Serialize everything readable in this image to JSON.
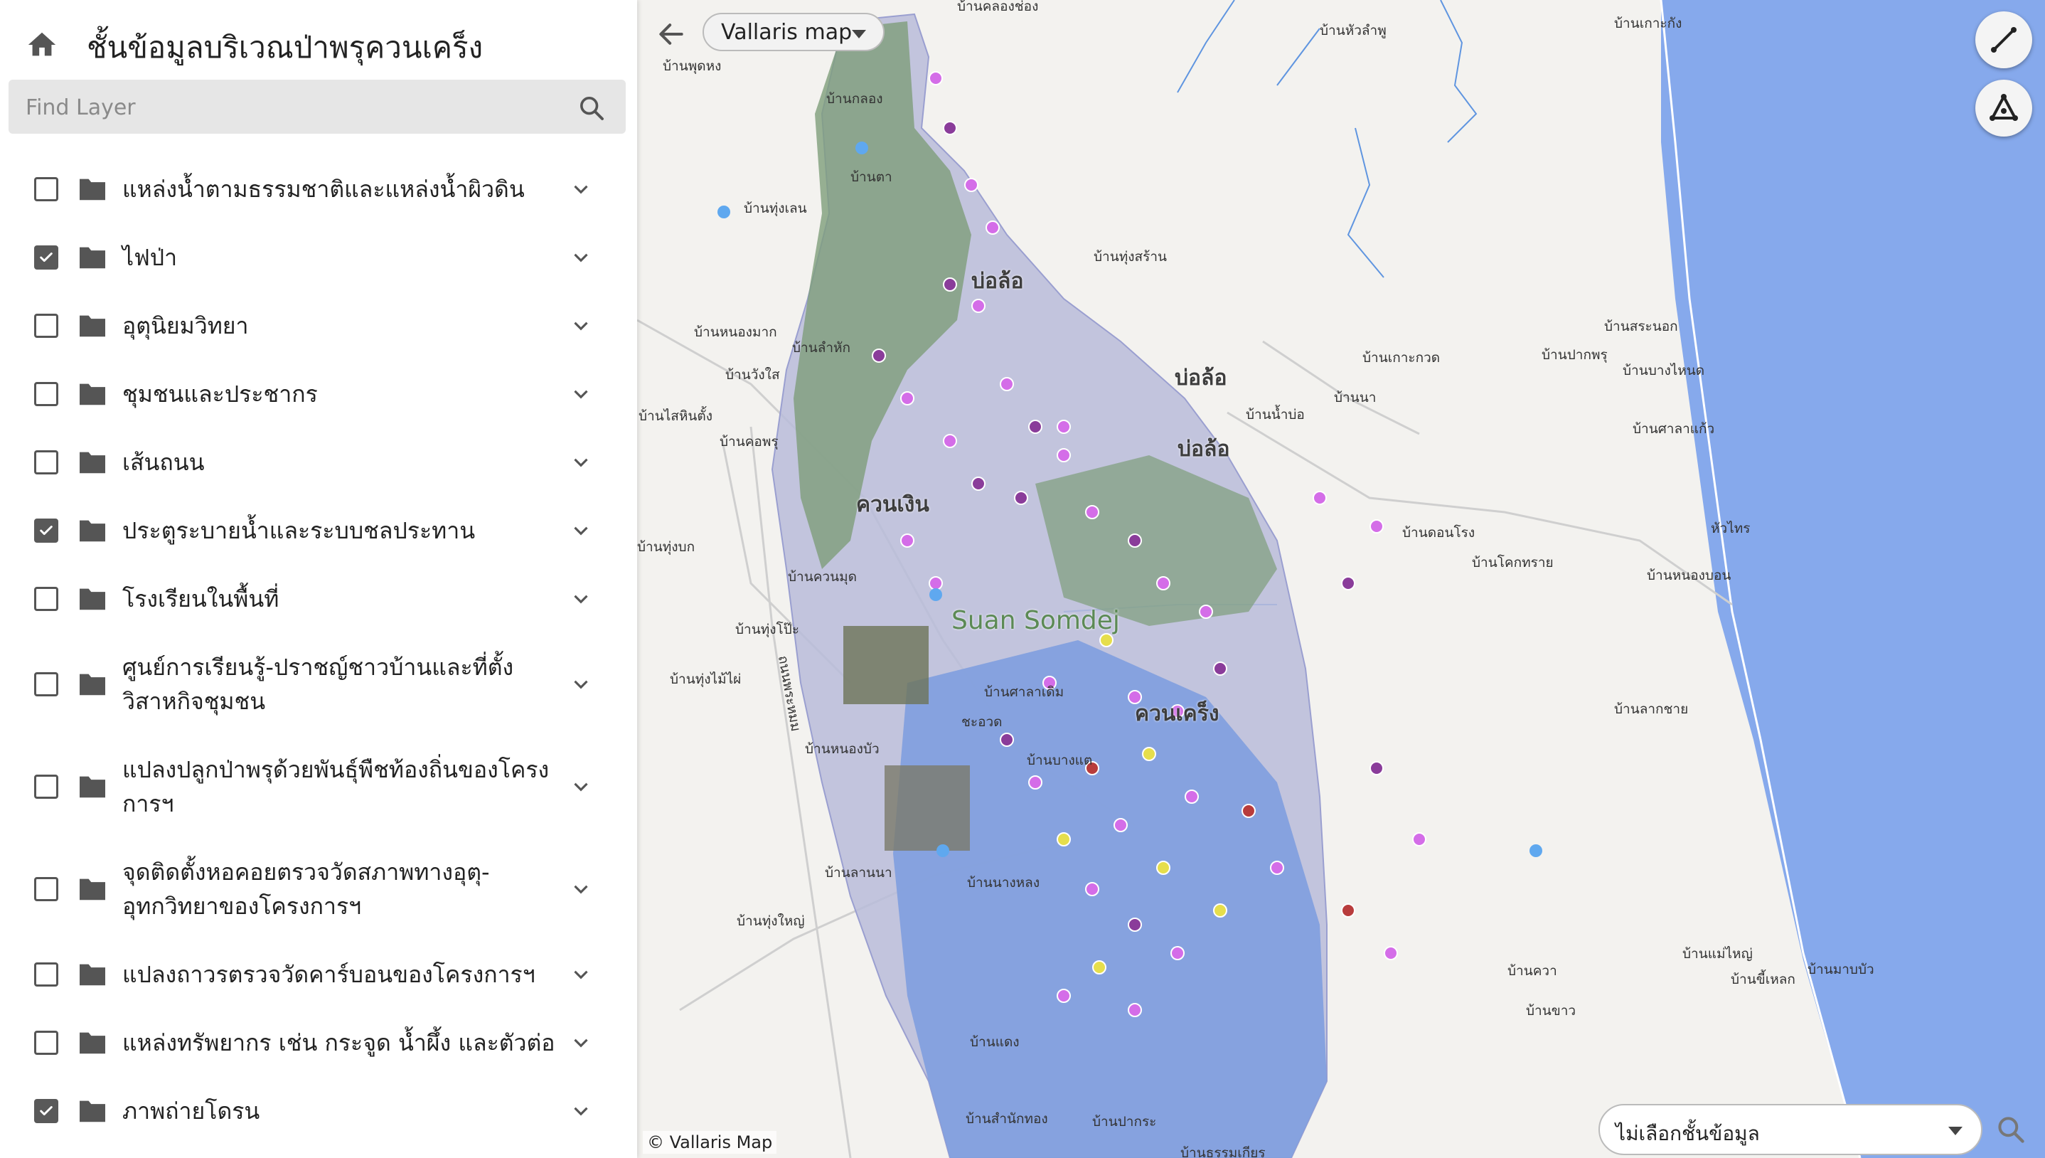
{
  "header": {
    "title": "ชั้นข้อมูลบริเวณป่าพรุควนเคร็ง",
    "search_placeholder": "Find Layer"
  },
  "layers": [
    {
      "label": "แหล่งน้ำตามธรรมชาติและแหล่งน้ำผิวดิน",
      "checked": false
    },
    {
      "label": "ไฟป่า",
      "checked": true
    },
    {
      "label": "อุตุนิยมวิทยา",
      "checked": false
    },
    {
      "label": "ชุมชนและประชากร",
      "checked": false
    },
    {
      "label": "เส้นถนน",
      "checked": false
    },
    {
      "label": "ประตูระบายน้ำและระบบชลประทาน",
      "checked": true
    },
    {
      "label": "โรงเรียนในพื้นที่",
      "checked": false
    },
    {
      "label": "ศูนย์การเรียนรู้-ปราชญ์ชาวบ้านและที่ตั้งวิสาหกิจชุมชน",
      "checked": false
    },
    {
      "label": "แปลงปลูกป่าพรุด้วยพันธุ์พืชท้องถิ่นของโครงการฯ",
      "checked": false
    },
    {
      "label": "จุดติดตั้งหอคอยตรวจวัดสภาพทางอุตุ-อุทกวิทยาของโครงการฯ",
      "checked": false
    },
    {
      "label": "แปลงถาวรตรวจวัดคาร์บอนของโครงการฯ",
      "checked": false
    },
    {
      "label": "แหล่งทรัพยากร เช่น กระจูด น้ำผึ้ง และตัวต่อ",
      "checked": false
    },
    {
      "label": "ภาพถ่ายโดรน",
      "checked": true
    }
  ],
  "map": {
    "basemap_label": "Vallaris map",
    "attribution": "© Vallaris Map",
    "data_select_label": "ไม่เลือกชั้นข้อมูล",
    "place_labels": [
      "บ้านคลองช่อง",
      "บ้านหัวลำพู",
      "บ้านเกาะกัง",
      "บ้านพุดหง",
      "บ้านกลอง",
      "บ้านตา",
      "บ้านทุ่งเลน",
      "บ้านทุ่งสร้าน",
      "บ้านหนองมาก",
      "บ้านลำหัก",
      "บ้านวังใส",
      "บ้านไสหินตั้ง",
      "บ้านคอพรุ",
      "บ้านสระนอก",
      "บ้านปากพรุ",
      "บ้านเกาะกวด",
      "บ้านบางไหนด",
      "บ้านนา",
      "บ้านน้ำบ่อ",
      "บ้านศาลาแก้ว",
      "หัวไทร",
      "บ้านโคกทราย",
      "บ้านดอนโรง",
      "บ้านหนองบอน",
      "บ้านทุ่งบก",
      "บ้านควนมุด",
      "บ้านทุ่งโป๊ะ",
      "บ้านทุ่งไม้ไผ่",
      "ชะอวด",
      "บ้านหนองบัว",
      "บ้านบางแต",
      "บ้านศาลาเดิม",
      "บ้านลากชาย",
      "บ้านลานนา",
      "บ้านนางหลง",
      "บ้านทุ่งใหญ่",
      "บ้านแม่ไหญ่",
      "บ้านมาบบัว",
      "บ้านขี้เหลก",
      "บ้านขาว",
      "บ้านควา",
      "บ้านแดง",
      "บ้านสำนักทอง",
      "บ้านปากระ",
      "บ้านธรรมเกียร",
      "ถนนพระหมม"
    ],
    "area_labels": [
      "ควนเงิน",
      "Suan Somdej",
      "บ่อล้อ",
      "บ่อล้อ",
      "ควนเคร็ง",
      "บ่อล้อ"
    ]
  }
}
